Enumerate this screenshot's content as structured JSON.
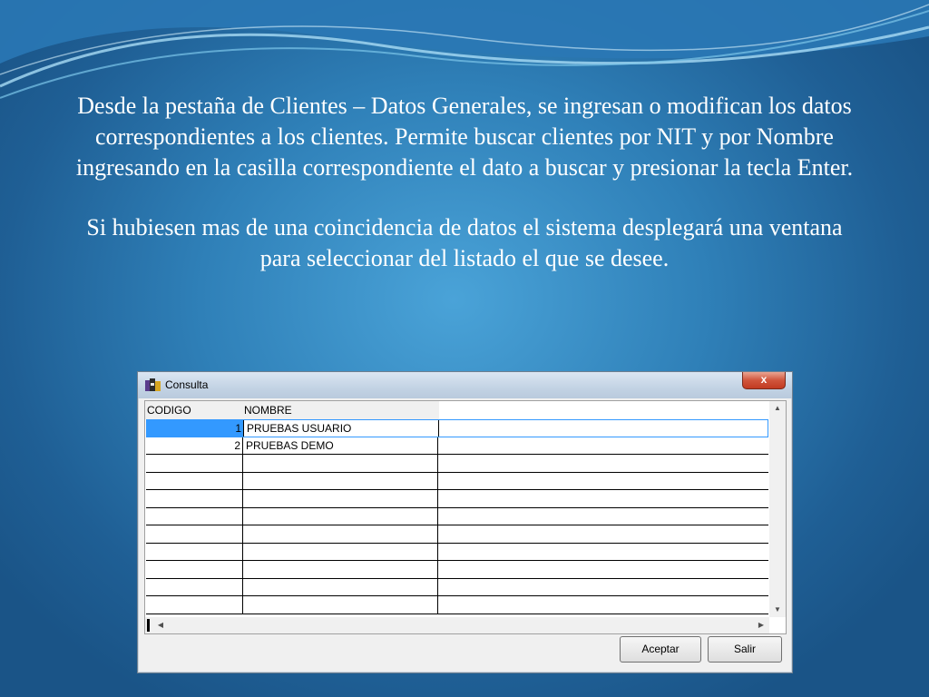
{
  "slide": {
    "paragraph_1": "Desde la pestaña de Clientes – Datos Generales, se ingresan o modifican los datos correspondientes a los clientes. Permite buscar clientes por NIT y por Nombre ingresando en la casilla correspondiente el dato a buscar y presionar la tecla Enter.",
    "paragraph_2": "Si hubiesen mas de una coincidencia de datos el sistema desplegará una ventana para seleccionar del listado el que se desee."
  },
  "window": {
    "title": "Consulta",
    "close_label": "x"
  },
  "grid": {
    "columns": [
      "CODIGO",
      "NOMBRE"
    ],
    "rows": [
      {
        "codigo": "1",
        "nombre": "PRUEBAS USUARIO",
        "selected": true
      },
      {
        "codigo": "2",
        "nombre": "PRUEBAS DEMO",
        "selected": false
      },
      {
        "codigo": "",
        "nombre": "",
        "selected": false
      },
      {
        "codigo": "",
        "nombre": "",
        "selected": false
      },
      {
        "codigo": "",
        "nombre": "",
        "selected": false
      },
      {
        "codigo": "",
        "nombre": "",
        "selected": false
      },
      {
        "codigo": "",
        "nombre": "",
        "selected": false
      },
      {
        "codigo": "",
        "nombre": "",
        "selected": false
      },
      {
        "codigo": "",
        "nombre": "",
        "selected": false
      },
      {
        "codigo": "",
        "nombre": "",
        "selected": false
      },
      {
        "codigo": "",
        "nombre": "",
        "selected": false
      }
    ]
  },
  "buttons": {
    "accept": "Aceptar",
    "exit": "Salir"
  },
  "colors": {
    "selection": "#3399ff",
    "background": "#2f80b8"
  },
  "icons": {
    "window_icon": "app-icon",
    "scroll_up": "arrow-up-icon",
    "scroll_down": "arrow-down-icon",
    "scroll_left": "arrow-left-icon",
    "scroll_right": "arrow-right-icon"
  }
}
